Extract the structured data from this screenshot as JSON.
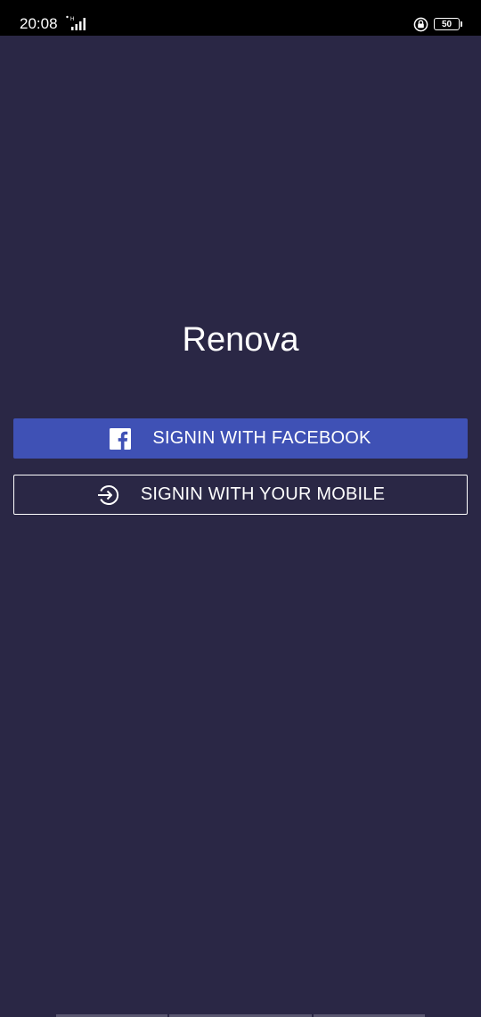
{
  "status_bar": {
    "time": "20:08",
    "signal_icon": "signal-icon",
    "lock_icon": "lock-icon",
    "battery_level": "50"
  },
  "app": {
    "title": "Renova"
  },
  "buttons": {
    "facebook": {
      "label": "SIGNIN WITH FACEBOOK",
      "icon": "facebook-icon",
      "color": "#3f51b5"
    },
    "mobile": {
      "label": "SIGNIN WITH YOUR MOBILE",
      "icon": "sign-in-icon"
    }
  },
  "colors": {
    "background": "#2a2745",
    "status_bar": "#000000"
  }
}
